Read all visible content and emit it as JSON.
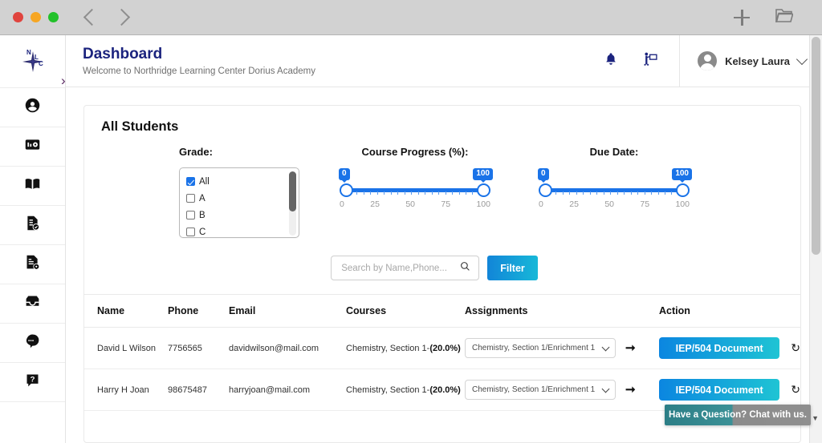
{
  "browser": {
    "traffic_lights": [
      "close",
      "minimize",
      "maximize"
    ],
    "back_label": "Back",
    "forward_label": "Forward",
    "new_tab_label": "+",
    "open_folder_label": "Open"
  },
  "sidebar": {
    "logo_letters": [
      "N",
      "L",
      "C"
    ],
    "expand_label": "›",
    "items": [
      {
        "name": "profile",
        "icon": "user-circle-icon"
      },
      {
        "name": "reports",
        "icon": "report-card-icon"
      },
      {
        "name": "courses",
        "icon": "open-book-icon"
      },
      {
        "name": "assignments",
        "icon": "document-check-icon"
      },
      {
        "name": "gradebook",
        "icon": "document-settings-icon"
      },
      {
        "name": "inbox",
        "icon": "inbox-icon"
      },
      {
        "name": "messages",
        "icon": "chat-bubbles-icon"
      },
      {
        "name": "help",
        "icon": "question-bubble-icon"
      }
    ]
  },
  "header": {
    "title": "Dashboard",
    "subtitle": "Welcome to Northridge Learning Center Dorius Academy",
    "notification_icon": "bell-icon",
    "presentation_icon": "presenter-icon",
    "user_name": "Kelsey Laura",
    "user_caret": "chevron-down-icon"
  },
  "main": {
    "card_title": "All Students",
    "filters": {
      "grade": {
        "label": "Grade:",
        "options": [
          {
            "label": "All",
            "checked": true
          },
          {
            "label": "A",
            "checked": false
          },
          {
            "label": "B",
            "checked": false
          },
          {
            "label": "C",
            "checked": false
          }
        ]
      },
      "course_progress": {
        "label": "Course Progress (%):",
        "min_value": "0",
        "max_value": "100",
        "scale": [
          "0",
          "25",
          "50",
          "75",
          "100"
        ]
      },
      "due_date": {
        "label": "Due Date:",
        "min_value": "0",
        "max_value": "100",
        "scale": [
          "0",
          "25",
          "50",
          "75",
          "100"
        ]
      },
      "search_placeholder": "Search by Name,Phone...",
      "search_value": "",
      "search_icon": "magnifier-icon",
      "filter_button": "Filter"
    },
    "table": {
      "columns": [
        "Name",
        "Phone",
        "Email",
        "Courses",
        "Assignments",
        "Action"
      ],
      "rows": [
        {
          "name": "David L Wilson",
          "phone": "7756565",
          "email": "davidwilson@mail.com",
          "course": "Chemistry, Section 1-",
          "course_pct": "(20.0%)",
          "assignment": "Chemistry, Section 1/Enrichment 1",
          "go_icon": "arrow-right-icon",
          "action_label": "IEP/504 Document",
          "undo_icon": "history-undo-icon"
        },
        {
          "name": "Harry H Joan",
          "phone": "98675487",
          "email": "harryjoan@mail.com",
          "course": "Chemistry, Section 1-",
          "course_pct": "(20.0%)",
          "assignment": "Chemistry, Section 1/Enrichment 1",
          "go_icon": "arrow-right-icon",
          "action_label": "IEP/504 Document",
          "undo_icon": "history-undo-icon"
        }
      ]
    }
  },
  "chat_widget": {
    "message": "Have a Question? Chat with us.",
    "minimize_icon": "caret-down-icon"
  },
  "colors": {
    "brand_navy": "#1b237e",
    "accent_blue": "#1a73e8",
    "button_gradient_start": "#0b86e0",
    "button_gradient_end": "#1fc4d4",
    "chat_teal": "#2c7e86"
  }
}
